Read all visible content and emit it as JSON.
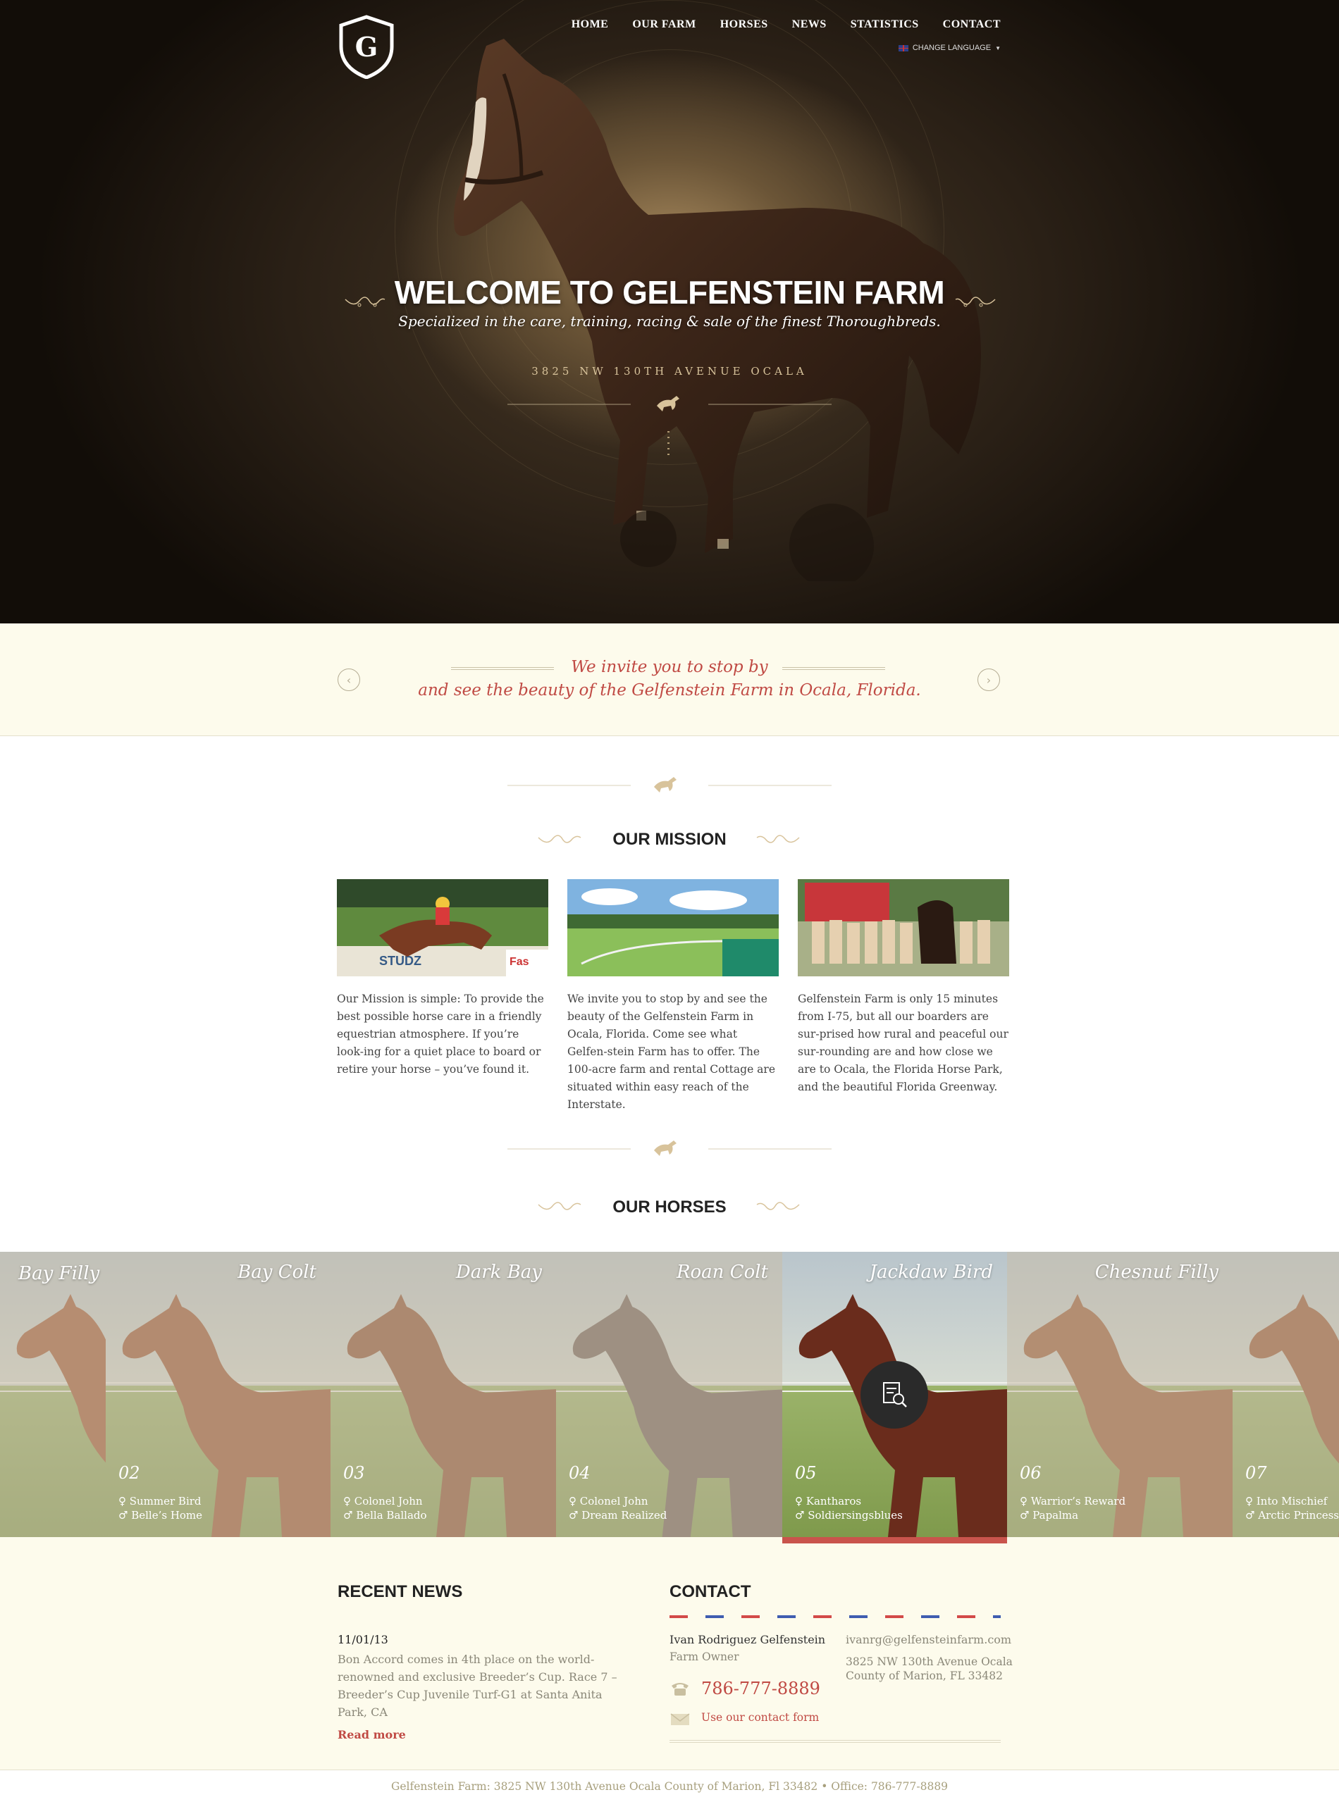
{
  "nav": {
    "items": [
      "HOME",
      "OUR FARM",
      "HORSES",
      "NEWS",
      "STATISTICS",
      "CONTACT"
    ],
    "language": "CHANGE LANGUAGE"
  },
  "hero": {
    "title": "WELCOME TO GELFENSTEIN FARM",
    "subtitle": "Specialized in the care, training, racing & sale of the finest Thoroughbreds.",
    "address": "3825 NW 130TH AVENUE OCALA"
  },
  "quote": {
    "line1": "We invite you to stop by",
    "line2": "and see the beauty of the Gelfenstein Farm in Ocala, Florida."
  },
  "mission": {
    "title": "OUR MISSION",
    "columns": [
      "Our Mission is simple: To provide the best possible horse care in a friendly equestrian atmosphere. If you’re look-ing for a quiet place to board or retire your horse – you’ve found it.",
      "We invite you to stop by and see the beauty of the Gelfenstein Farm in Ocala, Florida. Come see what Gelfen-stein Farm has to offer. The 100-acre farm and rental Cottage are situated within easy reach of the Interstate.",
      "Gelfenstein Farm is only 15 minutes from I-75, but all our boarders are sur-prised how rural and peaceful our sur-rounding are and how close we are to Ocala, the Florida Horse Park, and the beautiful Florida Greenway."
    ]
  },
  "horses": {
    "title": "OUR HORSES",
    "items": [
      {
        "name": "Bay Filly",
        "num": "",
        "sire": "",
        "dam": ""
      },
      {
        "name": "Bay Colt",
        "num": "02",
        "sire": "♀ Summer Bird",
        "dam": "♂ Belle’s Home"
      },
      {
        "name": "Dark Bay",
        "num": "03",
        "sire": "♀ Colonel John",
        "dam": "♂ Bella Ballado"
      },
      {
        "name": "Roan Colt",
        "num": "04",
        "sire": "♀ Colonel John",
        "dam": "♂ Dream Realized"
      },
      {
        "name": "Jackdaw Bird",
        "num": "05",
        "sire": "♀ Kantharos",
        "dam": "♂ Soldiersingsblues"
      },
      {
        "name": "Chesnut Filly",
        "num": "06",
        "sire": "♀ Warrior’s Reward",
        "dam": "♂ Papalma"
      },
      {
        "name": "",
        "num": "07",
        "sire": "♀ Into Mischief",
        "dam": "♂ Arctic Princess"
      }
    ]
  },
  "news": {
    "title": "RECENT NEWS",
    "date": "11/01/13",
    "body": "Bon Accord comes in 4th place on the world-renowned and exclusive Breeder’s Cup. Race 7 – Breeder’s Cup Juvenile Turf-G1 at Santa Anita Park, CA",
    "read_more": "Read more"
  },
  "contact": {
    "title": "CONTACT",
    "name": "Ivan Rodriguez Gelfenstein",
    "role": "Farm Owner",
    "phone": "786-777-8889",
    "form": "Use our contact form",
    "email": "ivanrg@gelfensteinfarm.com",
    "address1": "3825 NW 130th Avenue Ocala",
    "address2": "County of Marion, FL 33482"
  },
  "footer": {
    "text": "Gelfenstein Farm: 3825 NW 130th Avenue Ocala County of Marion, Fl 33482 • Office: 786-777-8889"
  },
  "colors": {
    "accent": "#c04a44",
    "cream": "#fdfbec",
    "hero_dark": "#2a2016"
  }
}
